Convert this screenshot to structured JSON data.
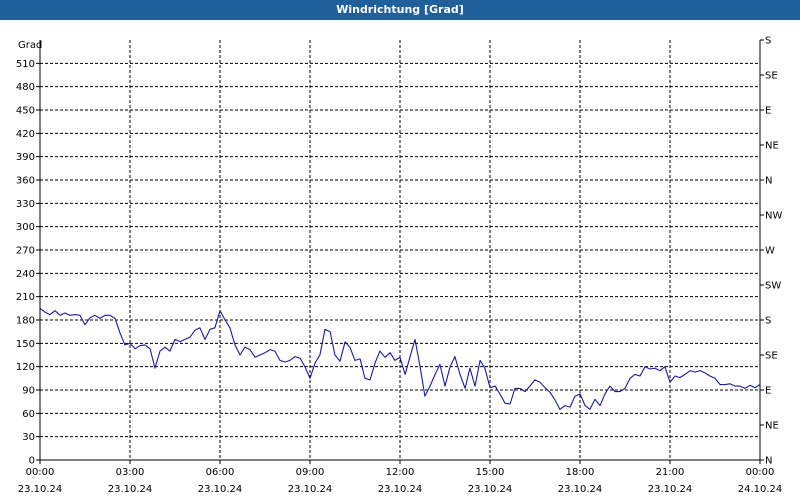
{
  "window": {
    "title": "Windrichtung [Grad]"
  },
  "colors": {
    "titlebar": "#1f5f9a",
    "line": "#1a1aa0",
    "grid": "#000000"
  },
  "chart_data": {
    "type": "line",
    "title": "",
    "ylabel": "Grad",
    "ylim": [
      0,
      540
    ],
    "yticks": [
      0,
      30,
      60,
      90,
      120,
      150,
      180,
      210,
      240,
      270,
      300,
      330,
      360,
      390,
      420,
      450,
      480,
      510
    ],
    "y2ticks": [
      {
        "value": 0,
        "label": "N"
      },
      {
        "value": 45,
        "label": "NE"
      },
      {
        "value": 90,
        "label": "E"
      },
      {
        "value": 135,
        "label": "SE"
      },
      {
        "value": 180,
        "label": "S"
      },
      {
        "value": 225,
        "label": "SW"
      },
      {
        "value": 270,
        "label": "W"
      },
      {
        "value": 315,
        "label": "NW"
      },
      {
        "value": 360,
        "label": "N"
      },
      {
        "value": 405,
        "label": "NE"
      },
      {
        "value": 450,
        "label": "E"
      },
      {
        "value": 495,
        "label": "SE"
      },
      {
        "value": 540,
        "label": "S"
      }
    ],
    "xlim": [
      0,
      24
    ],
    "xticks": [
      {
        "value": 0,
        "time": "00:00",
        "date": "23.10.24"
      },
      {
        "value": 3,
        "time": "03:00",
        "date": "23.10.24"
      },
      {
        "value": 6,
        "time": "06:00",
        "date": "23.10.24"
      },
      {
        "value": 9,
        "time": "09:00",
        "date": "23.10.24"
      },
      {
        "value": 12,
        "time": "12:00",
        "date": "23.10.24"
      },
      {
        "value": 15,
        "time": "15:00",
        "date": "23.10.24"
      },
      {
        "value": 18,
        "time": "18:00",
        "date": "23.10.24"
      },
      {
        "value": 21,
        "time": "21:00",
        "date": "23.10.24"
      },
      {
        "value": 24,
        "time": "00:00",
        "date": "24.10.24"
      }
    ],
    "grid": true,
    "series": [
      {
        "values": [
          [
            0.0,
            195
          ],
          [
            0.17,
            190
          ],
          [
            0.33,
            187
          ],
          [
            0.5,
            192
          ],
          [
            0.67,
            186
          ],
          [
            0.83,
            189
          ],
          [
            1.0,
            186
          ],
          [
            1.17,
            187
          ],
          [
            1.33,
            186
          ],
          [
            1.5,
            174
          ],
          [
            1.67,
            183
          ],
          [
            1.83,
            186
          ],
          [
            2.0,
            182
          ],
          [
            2.17,
            186
          ],
          [
            2.33,
            186
          ],
          [
            2.5,
            182
          ],
          [
            2.67,
            163
          ],
          [
            2.83,
            148
          ],
          [
            3.0,
            150
          ],
          [
            3.17,
            143
          ],
          [
            3.33,
            147
          ],
          [
            3.5,
            148
          ],
          [
            3.67,
            143
          ],
          [
            3.83,
            118
          ],
          [
            4.0,
            140
          ],
          [
            4.17,
            145
          ],
          [
            4.33,
            140
          ],
          [
            4.5,
            155
          ],
          [
            4.67,
            152
          ],
          [
            4.83,
            155
          ],
          [
            5.0,
            158
          ],
          [
            5.17,
            167
          ],
          [
            5.33,
            170
          ],
          [
            5.5,
            155
          ],
          [
            5.67,
            168
          ],
          [
            5.83,
            170
          ],
          [
            6.0,
            192
          ],
          [
            6.17,
            180
          ],
          [
            6.33,
            170
          ],
          [
            6.5,
            148
          ],
          [
            6.67,
            135
          ],
          [
            6.83,
            145
          ],
          [
            7.0,
            142
          ],
          [
            7.17,
            132
          ],
          [
            7.33,
            135
          ],
          [
            7.5,
            138
          ],
          [
            7.67,
            142
          ],
          [
            7.83,
            140
          ],
          [
            8.0,
            128
          ],
          [
            8.17,
            126
          ],
          [
            8.33,
            128
          ],
          [
            8.5,
            133
          ],
          [
            8.67,
            131
          ],
          [
            8.83,
            120
          ],
          [
            9.0,
            105
          ],
          [
            9.17,
            125
          ],
          [
            9.33,
            135
          ],
          [
            9.5,
            168
          ],
          [
            9.67,
            165
          ],
          [
            9.83,
            135
          ],
          [
            10.0,
            127
          ],
          [
            10.17,
            152
          ],
          [
            10.33,
            145
          ],
          [
            10.5,
            128
          ],
          [
            10.67,
            130
          ],
          [
            10.83,
            105
          ],
          [
            11.0,
            103
          ],
          [
            11.17,
            125
          ],
          [
            11.33,
            140
          ],
          [
            11.5,
            132
          ],
          [
            11.67,
            138
          ],
          [
            11.83,
            128
          ],
          [
            12.0,
            132
          ],
          [
            12.17,
            110
          ],
          [
            12.33,
            132
          ],
          [
            12.5,
            155
          ],
          [
            12.67,
            120
          ],
          [
            12.83,
            82
          ],
          [
            13.0,
            95
          ],
          [
            13.17,
            110
          ],
          [
            13.33,
            123
          ],
          [
            13.5,
            95
          ],
          [
            13.67,
            120
          ],
          [
            13.83,
            133
          ],
          [
            14.0,
            110
          ],
          [
            14.17,
            92
          ],
          [
            14.33,
            118
          ],
          [
            14.5,
            95
          ],
          [
            14.67,
            128
          ],
          [
            14.83,
            118
          ],
          [
            15.0,
            93
          ],
          [
            15.17,
            95
          ],
          [
            15.33,
            85
          ],
          [
            15.5,
            73
          ],
          [
            15.67,
            72
          ],
          [
            15.83,
            92
          ],
          [
            16.0,
            92
          ],
          [
            16.17,
            88
          ],
          [
            16.33,
            95
          ],
          [
            16.5,
            103
          ],
          [
            16.67,
            100
          ],
          [
            16.83,
            93
          ],
          [
            17.0,
            87
          ],
          [
            17.17,
            77
          ],
          [
            17.33,
            65
          ],
          [
            17.5,
            70
          ],
          [
            17.67,
            68
          ],
          [
            17.83,
            82
          ],
          [
            18.0,
            85
          ],
          [
            18.17,
            70
          ],
          [
            18.33,
            65
          ],
          [
            18.5,
            78
          ],
          [
            18.67,
            70
          ],
          [
            18.83,
            85
          ],
          [
            19.0,
            95
          ],
          [
            19.17,
            88
          ],
          [
            19.33,
            88
          ],
          [
            19.5,
            92
          ],
          [
            19.67,
            105
          ],
          [
            19.83,
            110
          ],
          [
            20.0,
            108
          ],
          [
            20.17,
            120
          ],
          [
            20.33,
            117
          ],
          [
            20.5,
            118
          ],
          [
            20.67,
            115
          ],
          [
            20.83,
            120
          ],
          [
            21.0,
            100
          ],
          [
            21.17,
            108
          ],
          [
            21.33,
            106
          ],
          [
            21.5,
            110
          ],
          [
            21.67,
            115
          ],
          [
            21.83,
            113
          ],
          [
            22.0,
            115
          ],
          [
            22.17,
            112
          ],
          [
            22.33,
            108
          ],
          [
            22.5,
            105
          ],
          [
            22.67,
            97
          ],
          [
            22.83,
            97
          ],
          [
            23.0,
            98
          ],
          [
            23.17,
            95
          ],
          [
            23.33,
            95
          ],
          [
            23.5,
            92
          ],
          [
            23.67,
            96
          ],
          [
            23.83,
            93
          ],
          [
            24.0,
            97
          ]
        ]
      }
    ]
  }
}
